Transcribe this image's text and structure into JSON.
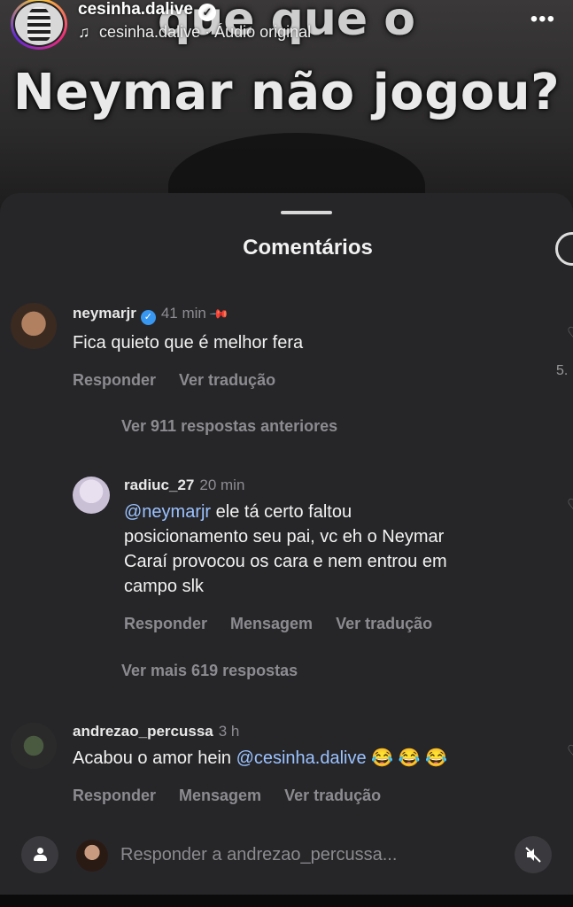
{
  "video": {
    "caption_line1": "que que o",
    "caption_line2": "Neymar não jogou?"
  },
  "header": {
    "username": "cesinha.dalive",
    "audio": "cesinha.dalive · Áudio original"
  },
  "sheet": {
    "title": "Comentários"
  },
  "comments": [
    {
      "user": "neymarjr",
      "time": "41 min",
      "text": "Fica quieto que é melhor fera",
      "actions": [
        "Responder",
        "Ver tradução"
      ],
      "side_count": "5.",
      "more_replies": "Ver 911 respostas anteriores"
    },
    {
      "user": "radiuc_27",
      "time": "20 min",
      "mention": "@neymarjr",
      "text_line1": " ele tá certo faltou",
      "text_line2": "posicionamento seu pai, vc eh o Neymar",
      "text_line3": "Caraí provocou os cara e nem entrou em",
      "text_line4": "campo slk",
      "actions": [
        "Responder",
        "Mensagem",
        "Ver tradução"
      ],
      "more_replies": "Ver mais 619 respostas"
    },
    {
      "user": "andrezao_percussa",
      "time": "3 h",
      "text": "Acabou o amor hein ",
      "mention": "@cesinha.dalive",
      "emoji": "😂 😂 😂",
      "actions": [
        "Responder",
        "Mensagem",
        "Ver tradução"
      ]
    }
  ],
  "reply_bar": {
    "placeholder": "Responder a andrezao_percussa..."
  }
}
